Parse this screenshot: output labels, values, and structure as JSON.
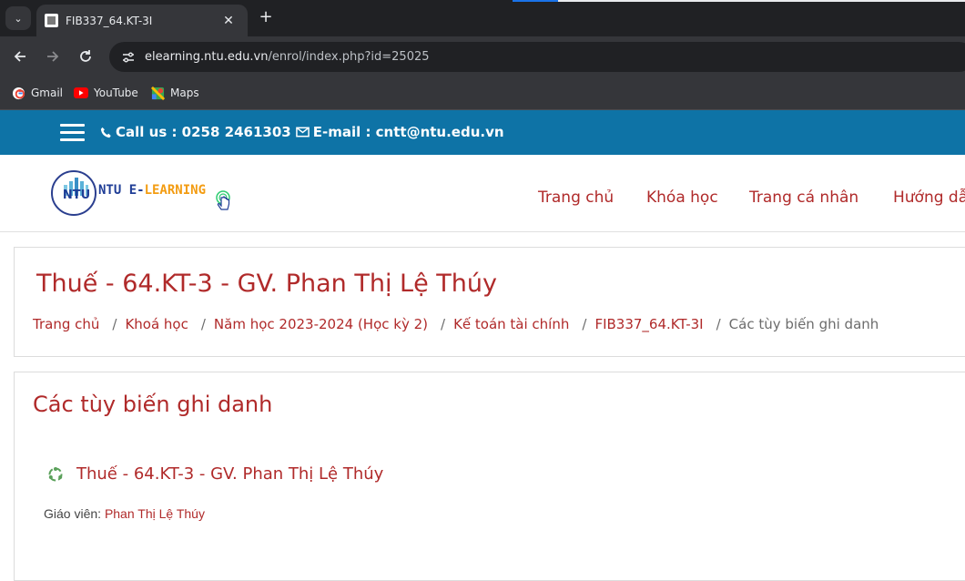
{
  "browser": {
    "tab_title": "FIB337_64.KT-3I",
    "tab_close": "✕",
    "new_tab": "+",
    "url_host": "elearning.ntu.edu.vn",
    "url_path": "/enrol/index.php?id=25025",
    "bookmarks": [
      {
        "label": "Gmail",
        "icon": "gmail-icon"
      },
      {
        "label": "YouTube",
        "icon": "youtube-icon"
      },
      {
        "label": "Maps",
        "icon": "maps-icon"
      }
    ]
  },
  "topbar": {
    "phone": "Call us : 0258 2461303",
    "email": "E-mail : cntt@ntu.edu.vn",
    "bg_color": "#0e73a6"
  },
  "logo": {
    "emblem_text": "NTU",
    "brand_part1": "NTU E-",
    "brand_part2": "LEARNING"
  },
  "nav": {
    "items": [
      "Trang chủ",
      "Khóa học",
      "Trang cá nhân",
      "Hướng dẫn"
    ]
  },
  "page": {
    "course_title": "Thuế - 64.KT-3 - GV. Phan Thị Lệ Thúy",
    "breadcrumb": [
      "Trang chủ",
      "Khoá học",
      "Năm học 2023-2024 (Học kỳ 2)",
      "Kế toán tài chính",
      "FIB337_64.KT-3I"
    ],
    "breadcrumb_separator": "/",
    "breadcrumb_current": "Các tùy biến ghi danh",
    "section_title": "Các tùy biến ghi danh",
    "course_link": "Thuế - 64.KT-3 - GV. Phan Thị Lệ Thúy",
    "teacher_label": "Giáo viên: ",
    "teacher_name": "Phan Thị Lệ Thúy"
  },
  "colors": {
    "accent": "#b02a2a",
    "browser_dark": "#202124",
    "browser_toolbar": "#35363a"
  }
}
